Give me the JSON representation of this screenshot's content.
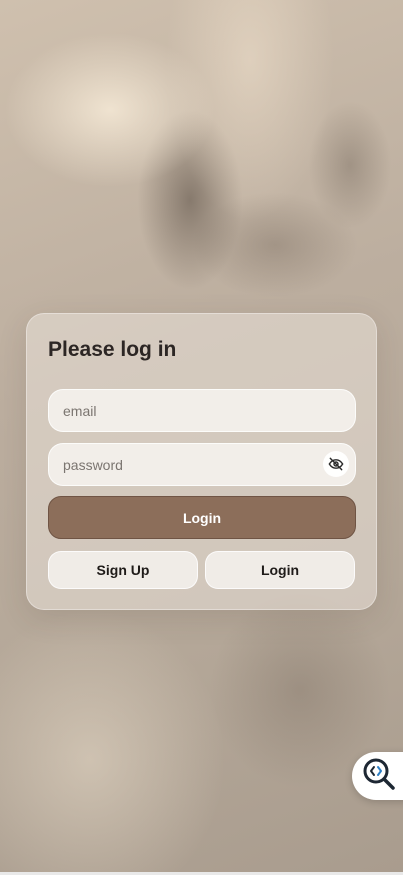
{
  "login_card": {
    "title": "Please log in",
    "email_placeholder": "email",
    "password_placeholder": "password",
    "login_label": "Login",
    "signup_label": "Sign Up",
    "secondary_login_label": "Login"
  },
  "icons": {
    "password_toggle": "eye-off-icon",
    "floating_widget": "code-search-icon"
  },
  "colors": {
    "primary_button": "#8c6e5a",
    "title_text": "#2c2624"
  }
}
